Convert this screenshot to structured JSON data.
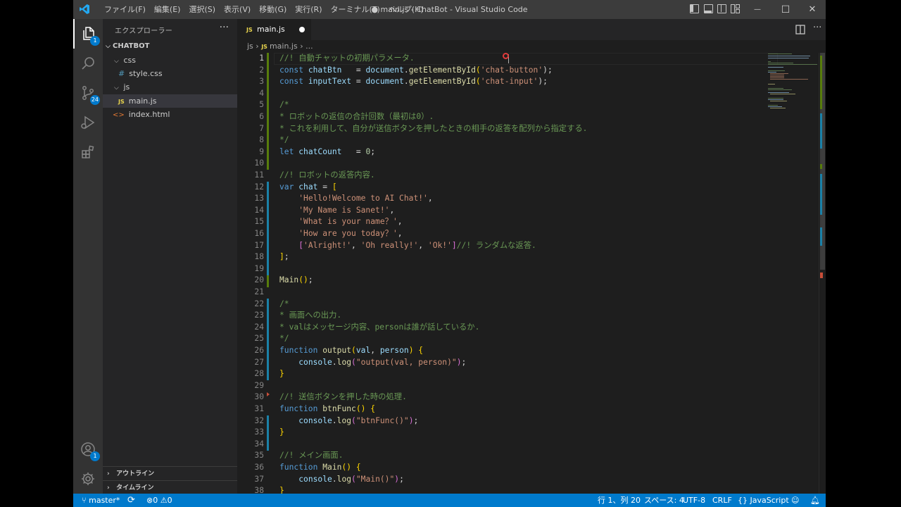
{
  "titlebar": {
    "menus": [
      "ファイル(F)",
      "編集(E)",
      "選択(S)",
      "表示(V)",
      "移動(G)",
      "実行(R)",
      "ターミナル(T)",
      "ヘルプ(H)"
    ],
    "title": "● main.js - ChatBot - Visual Studio Code",
    "minimize": "—",
    "maximize": "☐",
    "close": "✕"
  },
  "activity": {
    "source_control_badge": "24",
    "explorer_badge": "1",
    "accounts_badge": "1"
  },
  "sidebar": {
    "header": "エクスプローラー",
    "more": "···",
    "root": "CHATBOT",
    "folder_css": "css",
    "file_style": "style.css",
    "folder_js": "js",
    "file_main": "main.js",
    "file_index": "index.html",
    "js_icon": "JS",
    "css_icon": "#",
    "html_icon": "<>",
    "outline": "アウトライン",
    "timeline": "タイムライン"
  },
  "editor": {
    "tab_label": "main.js",
    "tab_icon": "JS",
    "breadcrumb": {
      "folder": "js",
      "file": "main.js",
      "rest": "..."
    },
    "line_numbers": [
      "1",
      "2",
      "3",
      "4",
      "5",
      "6",
      "7",
      "8",
      "9",
      "10",
      "11",
      "12",
      "13",
      "14",
      "15",
      "16",
      "17",
      "18",
      "19",
      "20",
      "21",
      "22",
      "23",
      "24",
      "25",
      "26",
      "27",
      "28",
      "29",
      "30",
      "31",
      "32",
      "33",
      "34",
      "35",
      "36",
      "37",
      "38"
    ],
    "code": {
      "l1": "//! 自動チャットの初期パラメータ.",
      "l2a": "const",
      "l2b": "chatBtn",
      "l2c": "   = ",
      "l2d": "document",
      "l2e": ".",
      "l2f": "getElementById",
      "l2g": "(",
      "l2h": "'chat-button'",
      "l2i": ");",
      "l3a": "const",
      "l3b": "inputText",
      "l3c": " = ",
      "l3d": "document",
      "l3e": ".",
      "l3f": "getElementById",
      "l3g": "(",
      "l3h": "'chat-input'",
      "l3i": ");",
      "l5": "/*",
      "l6": "* ロボットの返信の合計回数（最初は0）.",
      "l7": "* これを利用して、自分が送信ボタンを押したときの相手の返答を配列から指定する.",
      "l8": "*/",
      "l9a": "let",
      "l9b": "chatCount",
      "l9c": "   = ",
      "l9d": "0",
      "l9e": ";",
      "l11": "//! ロボットの返答内容.",
      "l12a": "var",
      "l12b": "chat",
      "l12c": " = ",
      "l12d": "[",
      "l13a": "    ",
      "l13b": "'Hello!Welcome to AI Chat!'",
      "l13c": ",",
      "l14a": "    ",
      "l14b": "'My Name is Sanet!'",
      "l14c": ",",
      "l15a": "    ",
      "l15b": "'What is your name？'",
      "l15c": ",",
      "l16a": "    ",
      "l16b": "'How are you today？'",
      "l16c": ",",
      "l17a": "    ",
      "l17b": "[",
      "l17c": "'Alright!'",
      "l17d": ", ",
      "l17e": "'Oh really!'",
      "l17f": ", ",
      "l17g": "'Ok!'",
      "l17h": "]",
      "l17i": "//! ランダムな返答.",
      "l18a": "]",
      "l18b": ";",
      "l20a": "Main",
      "l20b": "()",
      "l20c": ";",
      "l22": "/*",
      "l23": "* 画面への出力.",
      "l24": "* valはメッセージ内容、personは誰が話しているか.",
      "l25": "*/",
      "l26a": "function",
      "l26b": "output",
      "l26c": "(",
      "l26d": "val",
      "l26e": ", ",
      "l26f": "person",
      "l26g": ")",
      "l26h": " {",
      "l27a": "    ",
      "l27b": "console",
      "l27c": ".",
      "l27d": "log",
      "l27e": "(",
      "l27f": "\"output(val, person)\"",
      "l27g": ")",
      "l27h": ";",
      "l28": "}",
      "l30": "//! 送信ボタンを押した時の処理.",
      "l31a": "function",
      "l31b": "btnFunc",
      "l31c": "()",
      "l31d": " {",
      "l32a": "    ",
      "l32b": "console",
      "l32c": ".",
      "l32d": "log",
      "l32e": "(",
      "l32f": "\"btnFunc()\"",
      "l32g": ")",
      "l32h": ";",
      "l33": "}",
      "l35": "//! メイン画面.",
      "l36a": "function",
      "l36b": "Main",
      "l36c": "()",
      "l36d": " {",
      "l37a": "    ",
      "l37b": "console",
      "l37c": ".",
      "l37d": "log",
      "l37e": "(",
      "l37f": "\"Main()\"",
      "l37g": ")",
      "l37h": ";",
      "l38": "}"
    }
  },
  "statusbar": {
    "branch": "master*",
    "errors": "0",
    "warnings": "0",
    "position": "行 1、列 20",
    "spaces": "スペース: 4",
    "encoding": "UTF-8",
    "eol": "CRLF",
    "language": "JavaScript",
    "language_icon": "{}"
  },
  "colors": {
    "accent": "#007acc",
    "activity_bar": "#333333",
    "sidebar": "#252526",
    "editor": "#1e1e1e",
    "titlebar": "#3c3c3c"
  }
}
